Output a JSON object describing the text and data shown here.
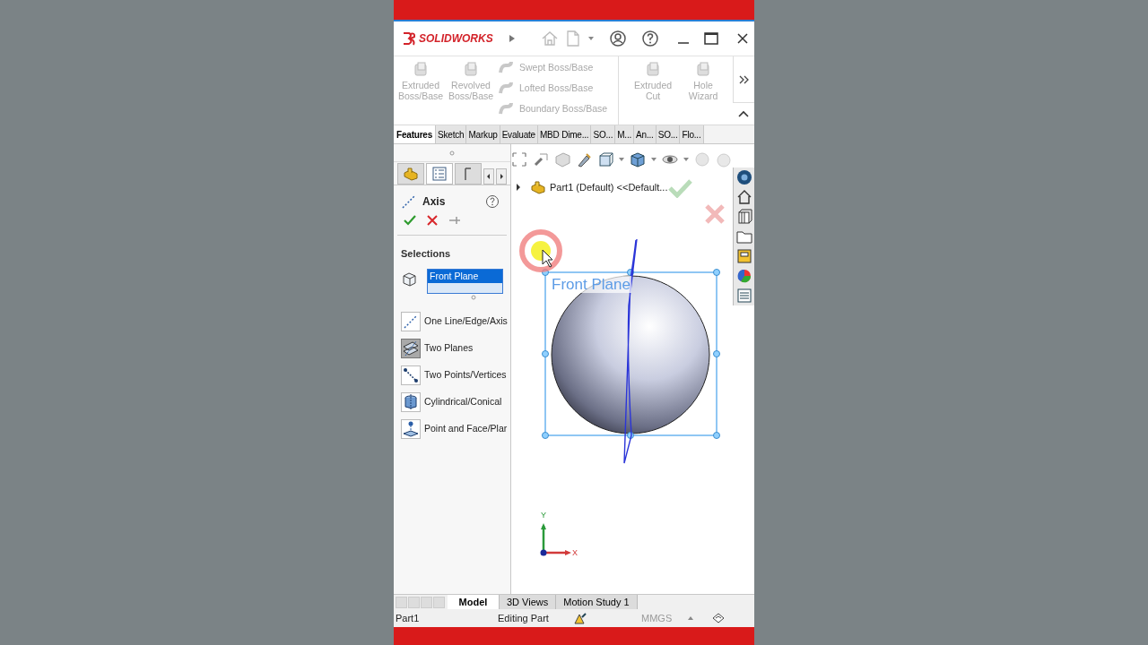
{
  "title_bar": {
    "logo_text": "SOLIDWORKS"
  },
  "ribbon": {
    "groups": [
      {
        "commands": [
          {
            "label": "Extruded Boss/Base",
            "kind": "large",
            "disabled": true
          },
          {
            "label": "Revolved Boss/Base",
            "kind": "large",
            "disabled": true
          },
          {
            "label": "Swept Boss/Base",
            "kind": "small",
            "disabled": true
          },
          {
            "label": "Lofted Boss/Base",
            "kind": "small",
            "disabled": true
          },
          {
            "label": "Boundary Boss/Base",
            "kind": "small",
            "disabled": true
          }
        ]
      },
      {
        "commands": [
          {
            "label": "Extruded Cut",
            "kind": "large",
            "disabled": true
          },
          {
            "label": "Hole Wizard",
            "kind": "large",
            "disabled": true
          }
        ]
      }
    ]
  },
  "ribbon_tabs": [
    {
      "label": "Features",
      "selected": true
    },
    {
      "label": "Sketch",
      "selected": false
    },
    {
      "label": "Markup",
      "selected": false
    },
    {
      "label": "Evaluate",
      "selected": false
    },
    {
      "label": "MBD Dime...",
      "selected": false
    },
    {
      "label": "SO...",
      "selected": false
    },
    {
      "label": "M...",
      "selected": false
    },
    {
      "label": "An...",
      "selected": false
    },
    {
      "label": "SO...",
      "selected": false
    },
    {
      "label": "Flo...",
      "selected": false
    }
  ],
  "property_manager": {
    "title": "Axis",
    "section": "Selections",
    "selection_field": {
      "value": "Front Plane"
    },
    "options": [
      {
        "label": "One Line/Edge/Axis",
        "kind": "line",
        "selected": false
      },
      {
        "label": "Two Planes",
        "kind": "planes",
        "selected": true
      },
      {
        "label": "Two Points/Vertices",
        "kind": "points",
        "selected": false
      },
      {
        "label": "Cylindrical/Conical",
        "kind": "cylinder",
        "selected": false
      },
      {
        "label": "Point and Face/Plar",
        "kind": "pointface",
        "selected": false
      }
    ]
  },
  "tree": {
    "item": "Part1 (Default) <<Default...",
    "expanded": false
  },
  "viewport": {
    "plane_label": "Front Plane",
    "triad": {
      "x": "X",
      "y": "Y"
    }
  },
  "bottom_tabs": [
    {
      "label": "Model",
      "selected": true
    },
    {
      "label": "3D Views",
      "selected": false
    },
    {
      "label": "Motion Study 1",
      "selected": false
    }
  ],
  "status_bar": {
    "document": "Part1",
    "mode": "Editing Part",
    "units": "MMGS"
  }
}
